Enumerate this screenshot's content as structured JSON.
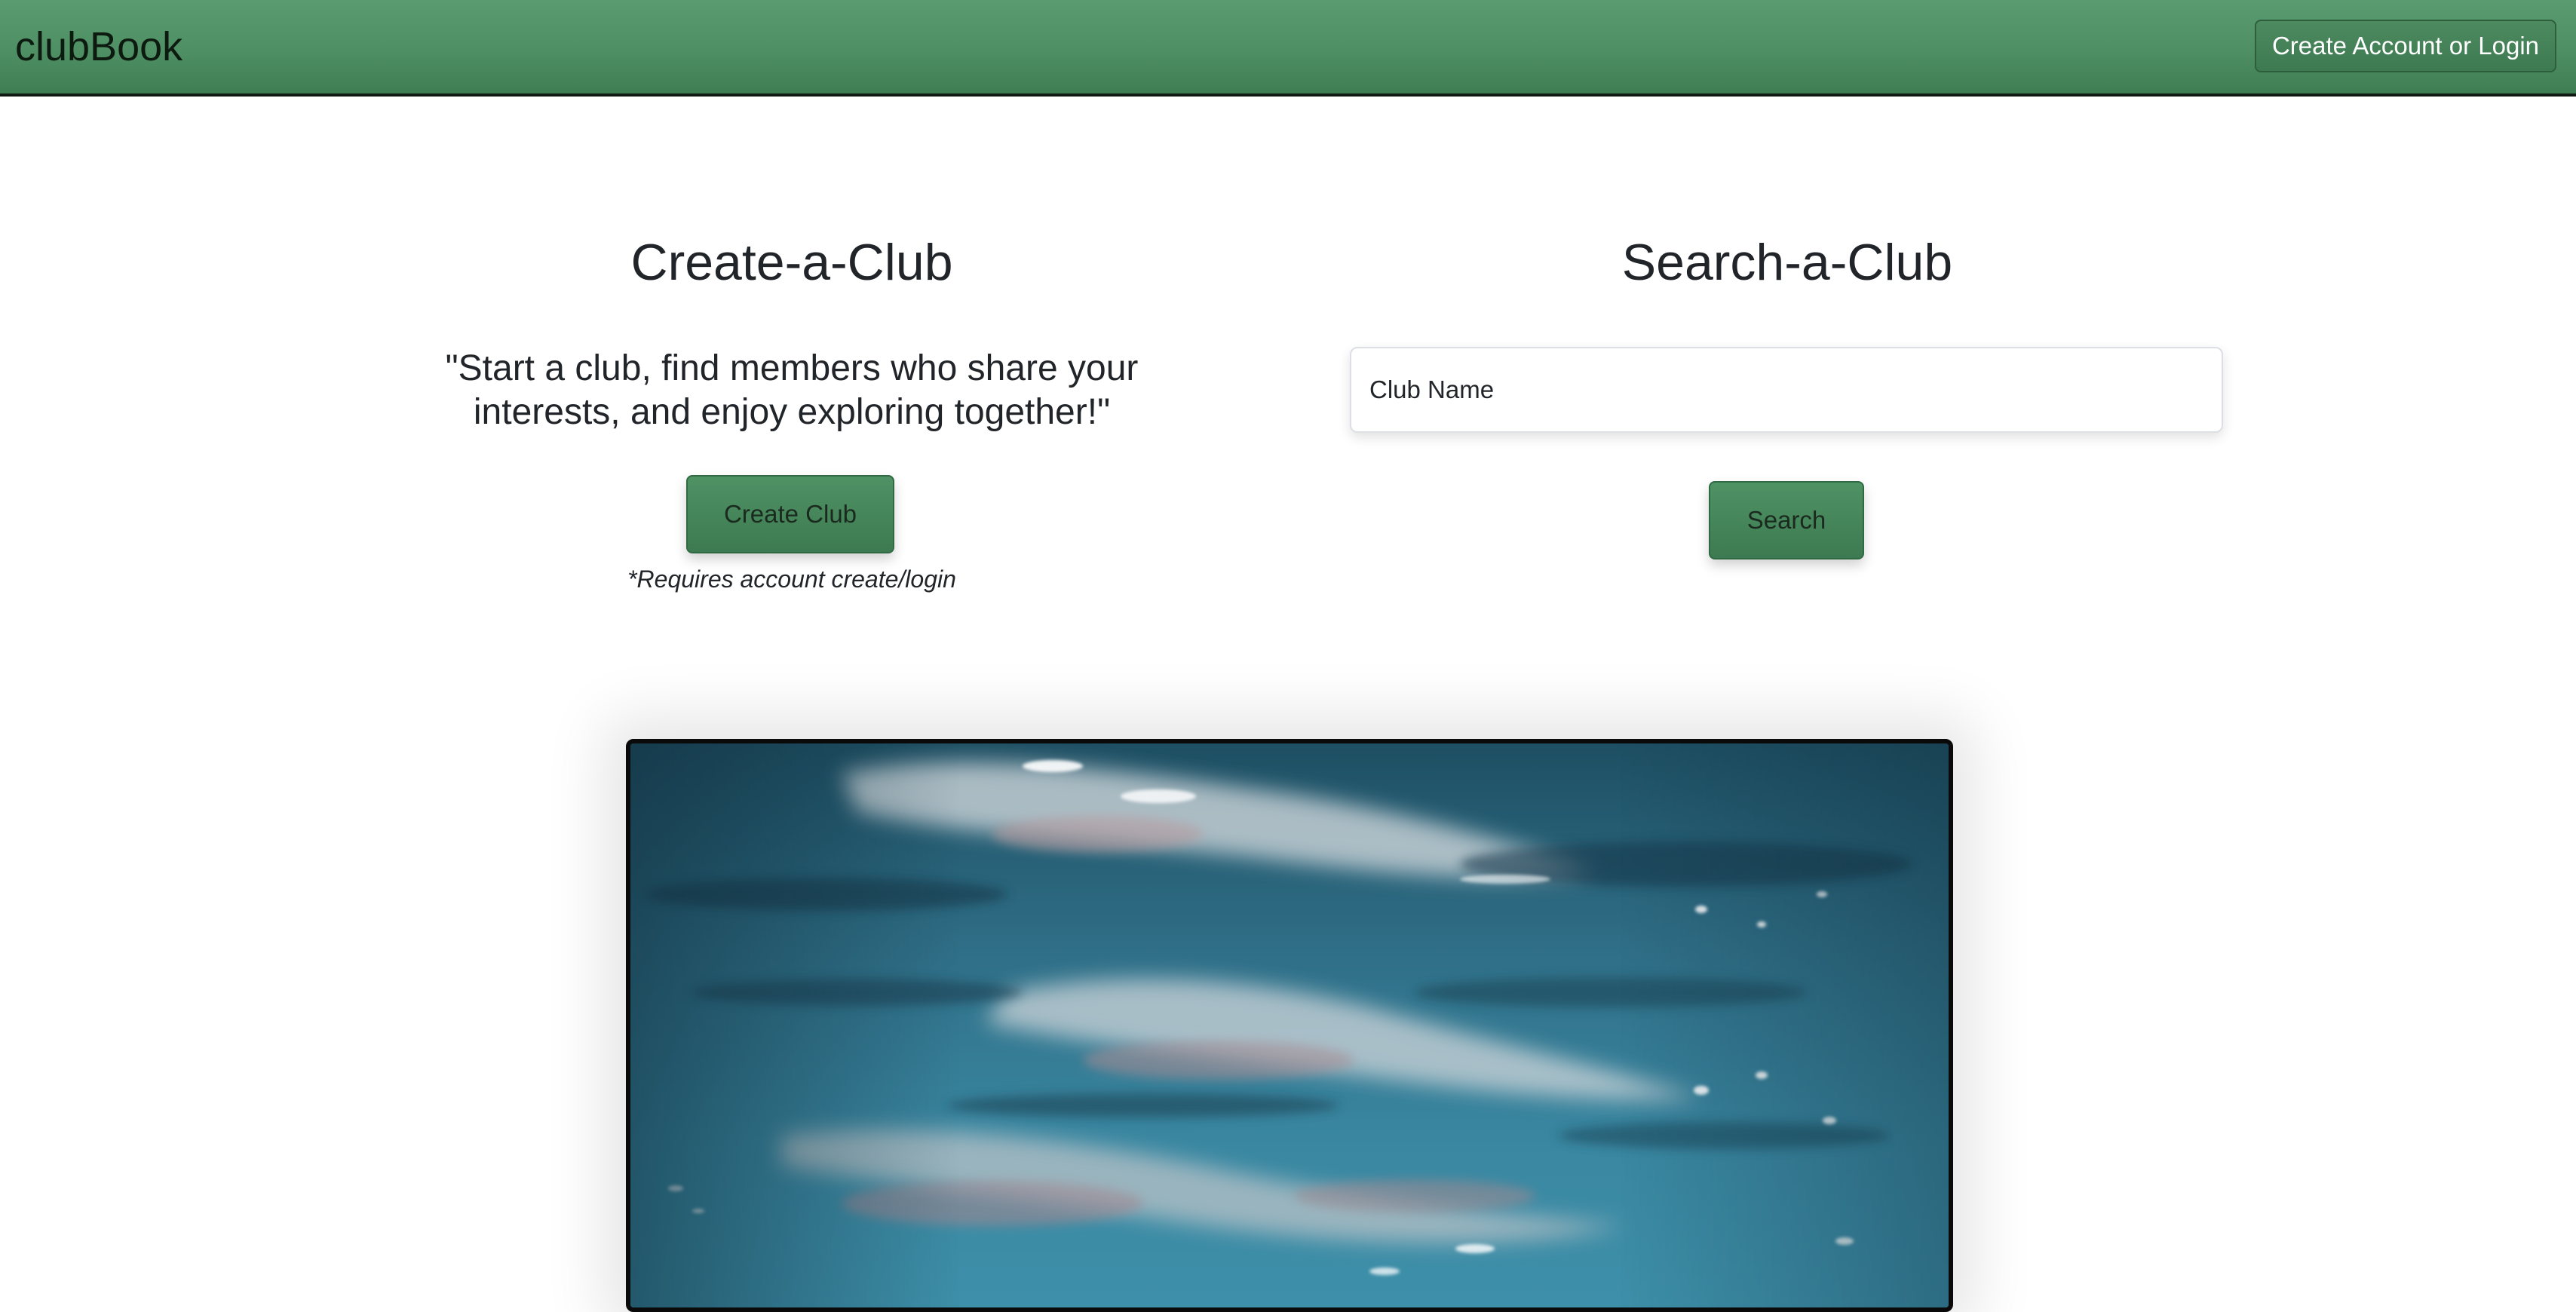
{
  "navbar": {
    "brand": "clubBook",
    "account_button": "Create Account or Login"
  },
  "create_section": {
    "title": "Create-a-Club",
    "tagline": "\"Start a club, find members who share your interests, and enjoy exploring together!\"",
    "button_label": "Create Club",
    "note": "*Requires account create/login"
  },
  "search_section": {
    "title": "Search-a-Club",
    "input_placeholder": "Club Name",
    "input_value": "",
    "button_label": "Search"
  },
  "hero_image": {
    "icon": "underwater-water-surface-image"
  },
  "colors": {
    "navbar_green": "#4f8f64",
    "button_green": "#458a5a",
    "text_dark": "#212529",
    "water_blue": "#2a6a86"
  }
}
